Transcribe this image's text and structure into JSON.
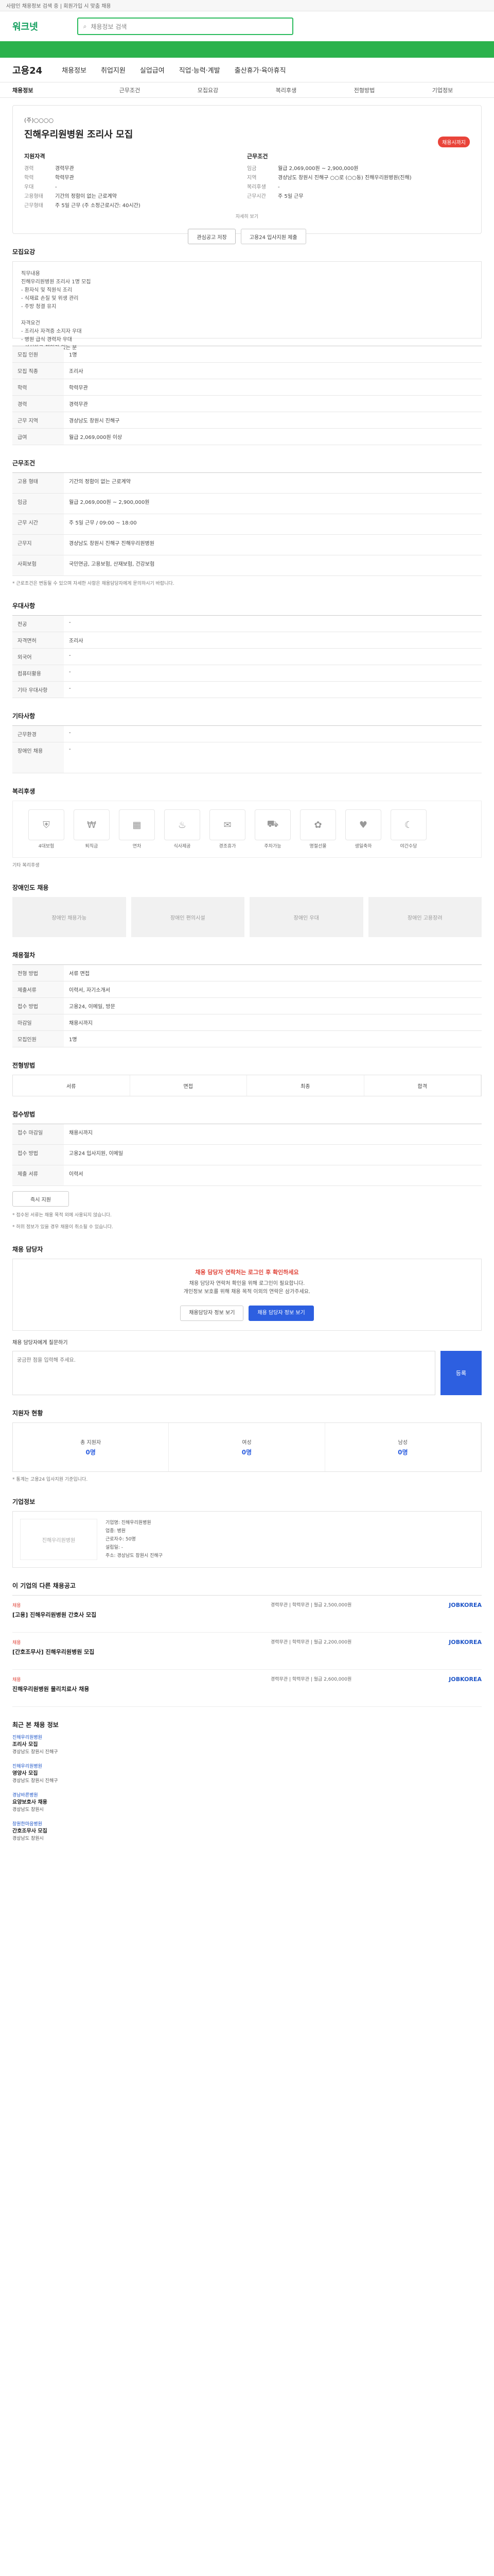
{
  "topbar": {
    "text": "사람인 채용정보 검색 중 | 회원가입 시 맞춤 채용"
  },
  "header": {
    "logo": "워크넷",
    "search_placeholder": "채용정보 검색"
  },
  "gnb": {
    "brand": "고용24",
    "menus": [
      "채용정보",
      "취업지원",
      "실업급여",
      "직업·능력·계발",
      "출산휴가·육아휴직"
    ]
  },
  "tabs": [
    "채용정보",
    "근무조건",
    "모집요강",
    "복리후생",
    "전형방법",
    "기업정보"
  ],
  "job": {
    "company": "(주)○○○○",
    "title": "진해우리원병원 조리사 모집",
    "badge": "채용시까지",
    "left_title": "지원자격",
    "left_rows": [
      [
        "경력",
        "경력무관"
      ],
      [
        "학력",
        "학력무관"
      ],
      [
        "우대",
        "-"
      ],
      [
        "고용형태",
        "기간의 정함이 없는 근로계약"
      ],
      [
        "근무형태",
        "주 5일 근무 (주 소정근로시간: 40시간)"
      ]
    ],
    "right_title": "근무조건",
    "right_rows": [
      [
        "임금",
        "월급 2,069,000원 ~ 2,900,000원"
      ],
      [
        "지역",
        "경상남도 창원시 진해구 ○○로 (○○동) 진해우리원병원(진해)"
      ],
      [
        "복리후생",
        "-"
      ],
      [
        "근무시간",
        "주 5일 근무"
      ]
    ],
    "detail_link": "자세히 보기",
    "save_label": "관심공고 저장",
    "apply_label": "고용24 입사지원 제출"
  },
  "sections": {
    "recruit": "모집요강",
    "recruit_text": "직무내용\n진해우리원병원 조리사 1명 모집\n- 환자식 및 직원식 조리\n- 식재료 손질 및 위생 관리\n- 주방 청결 유지\n\n자격요건\n- 조리사 자격증 소지자 우대\n- 병원 급식 경력자 우대\n- 성실하고 책임감 있는 분",
    "basic_rows": [
      [
        "모집 인원",
        "1명"
      ],
      [
        "모집 직종",
        "조리사"
      ],
      [
        "학력",
        "학력무관"
      ],
      [
        "경력",
        "경력무관"
      ],
      [
        "근무 지역",
        "경상남도 창원시 진해구"
      ],
      [
        "급여",
        "월급 2,069,000원 이상"
      ]
    ],
    "cond": "근무조건",
    "cond_rows": [
      [
        "고용 형태",
        "기간의 정함이 없는 근로계약"
      ],
      [
        "임금",
        "월급 2,069,000원 ~ 2,900,000원"
      ],
      [
        "근무 시간",
        "주 5일 근무 / 09:00 ~ 18:00"
      ],
      [
        "근무지",
        "경상남도 창원시 진해구 진해우리원병원"
      ],
      [
        "사회보험",
        "국민연금, 고용보험, 산재보험, 건강보험"
      ]
    ],
    "cond_note": "* 근로조건은 변동될 수 있으며 자세한 사항은 채용담당자에게 문의하시기 바랍니다.",
    "welfare": "우대사항",
    "welfare_rows": [
      [
        "전공",
        "-"
      ],
      [
        "자격면허",
        "조리사"
      ],
      [
        "외국어",
        "-"
      ],
      [
        "컴퓨터활용",
        "-"
      ],
      [
        "기타 우대사항",
        "-"
      ]
    ],
    "extra": "기타사항",
    "extra_rows": [
      [
        "근무환경",
        "-"
      ],
      [
        "장애인 채용",
        "-"
      ]
    ],
    "benefit": "복리후생",
    "benefit_icons": [
      "4대보험",
      "퇴직금",
      "연차",
      "식사제공",
      "경조휴가",
      "주차가능",
      "명절선물",
      "생일축하",
      "야간수당"
    ],
    "benefit_etc": "기타 복리후생",
    "disabled": "장애인도 채용",
    "disabled_items": [
      "장애인 채용가능",
      "장애인 편의시설",
      "장애인 우대",
      "장애인 고용장려"
    ],
    "process": "채용절차",
    "process_rows": [
      [
        "전형 방법",
        "서류 면접"
      ],
      [
        "제출서류",
        "이력서, 자기소개서"
      ],
      [
        "접수 방법",
        "고용24, 이메일, 방문"
      ],
      [
        "마감일",
        "채용시까지"
      ],
      [
        "모집인원",
        "1명"
      ]
    ],
    "method": "전형방법",
    "steps": [
      "서류",
      "면접",
      "최종",
      "합격"
    ],
    "apply": "접수방법",
    "apply_rows": [
      [
        "접수 마감일",
        "채용시까지"
      ],
      [
        "접수 방법",
        "고용24 입사지원, 이메일"
      ],
      [
        "제출 서류",
        "이력서"
      ]
    ],
    "apply_btn": "즉시 지원",
    "apply_notice": "* 접수된 서류는 채용 목적 외에 사용되지 않습니다.",
    "apply_notice_red": "* 허위 정보가 있을 경우 채용이 취소될 수 있습니다.",
    "contact": "채용 담당자",
    "contact_warn": "채용 담당자 연락처는 로그인 후 확인하세요",
    "contact_text": "채용 담당자 연락처 확인을 위해 로그인이 필요합니다.\n개인정보 보호를 위해 채용 목적 이외의 연락은 삼가주세요.",
    "contact_btn1": "채용담당자 정보 보기",
    "contact_btn2": "채용 담당자 정보 보기",
    "inquiry_label": "채용 담당자에게 질문하기",
    "inquiry_placeholder": "궁금한 점을 입력해 주세요.",
    "inquiry_submit": "등록",
    "stats": "지원자 현황",
    "stat_items": [
      [
        "총 지원자",
        "0명"
      ],
      [
        "여성",
        "0명"
      ],
      [
        "남성",
        "0명"
      ]
    ],
    "stat_note": "* 통계는 고용24 입사지원 기준입니다.",
    "company": "기업정보",
    "company_name": "진해우리원병원",
    "company_rows": "기업명: 진해우리원병원\n업종: 병원\n근로자수: 50명\n설립일: -\n주소: 경상남도 창원시 진해구",
    "similar": "이 기업의 다른 채용공고",
    "similar_items": [
      {
        "tag": "채용",
        "title": "[고용] 진해우리원병원 간호사 모집",
        "meta": "경력무관 | 학력무관 | 월급 2,500,000원",
        "site": "JOBKOREA"
      },
      {
        "tag": "채용",
        "title": "[간호조무사] 진해우리원병원 모집",
        "meta": "경력무관 | 학력무관 | 월급 2,200,000원",
        "site": "JOBKOREA"
      },
      {
        "tag": "채용",
        "title": "진해우리원병원 물리치료사 채용",
        "meta": "경력무관 | 학력무관 | 월급 2,600,000원",
        "site": "JOBKOREA"
      }
    ],
    "recent": "최근 본 채용 정보",
    "recent_items": [
      {
        "t": "진해우리원병원",
        "b": "조리사 모집",
        "d": "경상남도 창원시 진해구"
      },
      {
        "t": "진해우리원병원",
        "b": "영양사 모집",
        "d": "경상남도 창원시 진해구"
      },
      {
        "t": "경남바른병원",
        "b": "요양보호사 채용",
        "d": "경상남도 창원시"
      },
      {
        "t": "창원한마음병원",
        "b": "간호조무사 모집",
        "d": "경상남도 창원시"
      }
    ]
  }
}
